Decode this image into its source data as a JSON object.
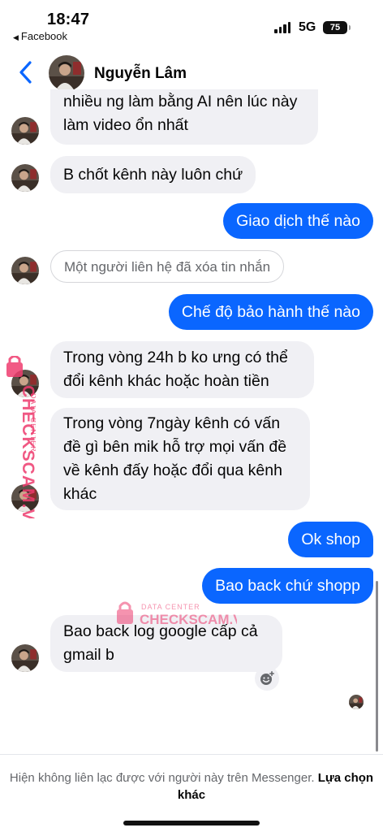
{
  "status_bar": {
    "time": "18:47",
    "back_app": "Facebook",
    "network": "5G",
    "battery": "75"
  },
  "header": {
    "contact_name": "Nguyễn Lâm"
  },
  "messages": [
    {
      "side": "in",
      "text": "nhiều ng làm bằng AI nên lúc này làm video ổn nhất"
    },
    {
      "side": "in",
      "text": "B chốt kênh này luôn chứ"
    },
    {
      "side": "out",
      "text": "Giao dịch thế nào"
    },
    {
      "side": "in",
      "text": "Một người liên hệ đã xóa tin nhắn",
      "deleted": true
    },
    {
      "side": "out",
      "text": "Chế độ bảo hành thế nào"
    },
    {
      "side": "in",
      "text": "Trong vòng 24h b ko ưng có thể đổi kênh khác hoặc hoàn tiền"
    },
    {
      "side": "in",
      "text": "Trong vòng 7ngày kênh có vấn đề gì bên mik hỗ trợ mọi vấn đề về kênh đấy hoặc đổi qua kênh khác"
    },
    {
      "side": "out",
      "text": "Ok shop"
    },
    {
      "side": "out",
      "text": "Bao back chứ shopp"
    },
    {
      "side": "in",
      "text": "Bao back log google cấp cả gmail b"
    }
  ],
  "watermark": {
    "brand": "CHECKSCAM.VN",
    "sub": "DATA CENTER"
  },
  "footer": {
    "notice": "Hiện không liên lạc được với người này trên Messenger.",
    "link": "Lựa chọn khác"
  },
  "icons": {
    "back": "chevron-left-icon",
    "react": "add-reaction-icon"
  },
  "colors": {
    "accent": "#0a66ff",
    "incoming_bubble": "#f0f0f4",
    "watermark": "#ee3c6e"
  }
}
